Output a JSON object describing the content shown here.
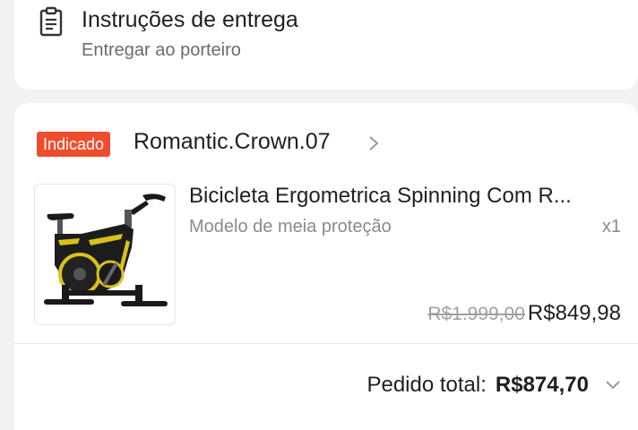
{
  "delivery": {
    "icon": "clipboard-icon",
    "title": "Instruções de entrega",
    "subtitle": "Entregar ao porteiro"
  },
  "shop": {
    "badge": "Indicado",
    "badge_color": "#ee4d2d",
    "name": "Romantic.Crown.07",
    "chevron_icon": "chevron-right-icon"
  },
  "product": {
    "image_icon": "exercise-bike-image",
    "name": "Bicicleta Ergometrica Spinning Com R...",
    "variant": "Modelo de meia proteção",
    "quantity": "x1",
    "original_price": "R$1.999,00",
    "price": "R$849,98"
  },
  "order": {
    "total_label": "Pedido total:",
    "total_value": "R$874,70",
    "expand_icon": "chevron-down-icon"
  }
}
